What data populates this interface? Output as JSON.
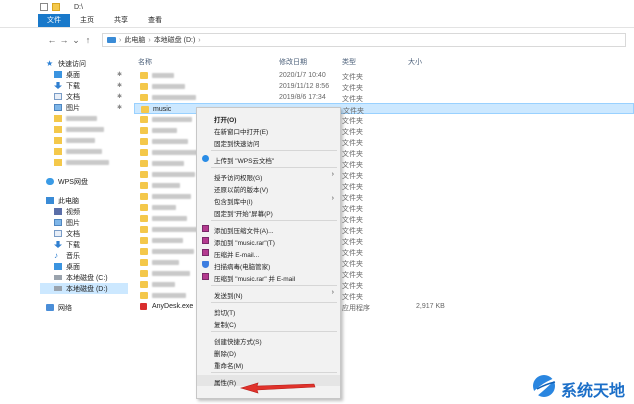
{
  "window": {
    "title": "D:\\"
  },
  "ribbon": {
    "tabs": [
      "文件",
      "主页",
      "共享",
      "查看"
    ]
  },
  "address": {
    "path": [
      "此电脑",
      "本地磁盘 (D:)"
    ]
  },
  "navpane": {
    "items": [
      {
        "label": "快速访问",
        "icon": "star-icon",
        "pin": false,
        "indent": 0
      },
      {
        "label": "桌面",
        "icon": "desktop-icon",
        "pin": true,
        "indent": 1
      },
      {
        "label": "下载",
        "icon": "download-icon",
        "pin": true,
        "indent": 1
      },
      {
        "label": "文档",
        "icon": "document-icon",
        "pin": true,
        "indent": 1
      },
      {
        "label": "图片",
        "icon": "picture-icon",
        "pin": true,
        "indent": 1
      },
      {
        "label": "",
        "icon": "folder-icon",
        "pin": false,
        "indent": 1,
        "blurred": true
      },
      {
        "label": "",
        "icon": "folder-icon",
        "pin": false,
        "indent": 1,
        "blurred": true
      },
      {
        "label": "",
        "icon": "folder-icon",
        "pin": false,
        "indent": 1,
        "blurred": true
      },
      {
        "label": "",
        "icon": "folder-icon",
        "pin": false,
        "indent": 1,
        "blurred": true
      },
      {
        "label": "",
        "icon": "folder-icon",
        "pin": false,
        "indent": 1,
        "blurred": true
      },
      {
        "label": "",
        "gap": true
      },
      {
        "label": "WPS网盘",
        "icon": "cloud-icon",
        "pin": false,
        "indent": 0
      },
      {
        "label": "",
        "gap": true
      },
      {
        "label": "此电脑",
        "icon": "pc-icon",
        "pin": false,
        "indent": 0
      },
      {
        "label": "视频",
        "icon": "video-icon",
        "pin": false,
        "indent": 1
      },
      {
        "label": "图片",
        "icon": "picture-icon",
        "pin": false,
        "indent": 1
      },
      {
        "label": "文档",
        "icon": "document-icon",
        "pin": false,
        "indent": 1
      },
      {
        "label": "下载",
        "icon": "download-icon",
        "pin": false,
        "indent": 1
      },
      {
        "label": "音乐",
        "icon": "music-icon",
        "pin": false,
        "indent": 1
      },
      {
        "label": "桌面",
        "icon": "desktop-icon",
        "pin": false,
        "indent": 1
      },
      {
        "label": "本地磁盘 (C:)",
        "icon": "drive-icon",
        "pin": false,
        "indent": 1
      },
      {
        "label": "本地磁盘 (D:)",
        "icon": "drive-icon",
        "pin": false,
        "indent": 1,
        "selected": true
      },
      {
        "label": "",
        "gap": true
      },
      {
        "label": "网络",
        "icon": "network-icon",
        "pin": false,
        "indent": 0
      }
    ]
  },
  "columns": {
    "name": "名称",
    "date": "修改日期",
    "type": "类型",
    "size": "大小"
  },
  "files": [
    {
      "name": "",
      "blurred": true,
      "date": "2020/1/7 10:40",
      "type": "文件夹",
      "size": ""
    },
    {
      "name": "",
      "blurred": true,
      "date": "2019/11/12 8:56",
      "type": "文件夹",
      "size": ""
    },
    {
      "name": "",
      "blurred": true,
      "date": "2019/8/6 17:34",
      "type": "文件夹",
      "size": ""
    },
    {
      "name": "music",
      "blurred": false,
      "date": "",
      "type": "文件夹",
      "size": "",
      "selected": true
    },
    {
      "name": "",
      "blurred": true,
      "date": "",
      "type": "文件夹",
      "size": ""
    },
    {
      "name": "",
      "blurred": true,
      "date": "",
      "type": "文件夹",
      "size": ""
    },
    {
      "name": "",
      "blurred": true,
      "date": "",
      "type": "文件夹",
      "size": ""
    },
    {
      "name": "",
      "blurred": true,
      "date": "",
      "type": "文件夹",
      "size": ""
    },
    {
      "name": "",
      "blurred": true,
      "date": "",
      "type": "文件夹",
      "size": ""
    },
    {
      "name": "",
      "blurred": true,
      "date": "",
      "type": "文件夹",
      "size": ""
    },
    {
      "name": "",
      "blurred": true,
      "date": "",
      "type": "文件夹",
      "size": ""
    },
    {
      "name": "",
      "blurred": true,
      "date": "",
      "type": "文件夹",
      "size": ""
    },
    {
      "name": "",
      "blurred": true,
      "date": "",
      "type": "文件夹",
      "size": ""
    },
    {
      "name": "",
      "blurred": true,
      "date": "",
      "type": "文件夹",
      "size": ""
    },
    {
      "name": "",
      "blurred": true,
      "date": "",
      "type": "文件夹",
      "size": ""
    },
    {
      "name": "",
      "blurred": true,
      "date": "",
      "type": "文件夹",
      "size": ""
    },
    {
      "name": "",
      "blurred": true,
      "date": "",
      "type": "文件夹",
      "size": ""
    },
    {
      "name": "",
      "blurred": true,
      "date": "",
      "type": "文件夹",
      "size": ""
    },
    {
      "name": "",
      "blurred": true,
      "date": "",
      "type": "文件夹",
      "size": ""
    },
    {
      "name": "",
      "blurred": true,
      "date": "",
      "type": "文件夹",
      "size": ""
    },
    {
      "name": "",
      "blurred": true,
      "date": "",
      "type": "文件夹",
      "size": ""
    },
    {
      "name": "AnyDesk.exe",
      "blurred": false,
      "date": "",
      "type": "应用程序",
      "size": "2,917 KB",
      "exe": true
    }
  ],
  "context_menu": {
    "items": [
      {
        "label": "打开(O)",
        "bold": true
      },
      {
        "label": "在新窗口中打开(E)"
      },
      {
        "label": "固定到快速访问"
      },
      {
        "sep": true
      },
      {
        "label": "上传到 \"WPS云文档\"",
        "icon": "wps-cloud-icon"
      },
      {
        "sep": true
      },
      {
        "label": "授予访问权限(G)",
        "submenu": true
      },
      {
        "label": "还原以前的版本(V)"
      },
      {
        "label": "包含到库中(I)",
        "submenu": true
      },
      {
        "label": "固定到\"开始\"屏幕(P)"
      },
      {
        "sep": true
      },
      {
        "label": "添加到压缩文件(A)...",
        "icon": "winrar-icon"
      },
      {
        "label": "添加到 \"music.rar\"(T)",
        "icon": "winrar-icon"
      },
      {
        "label": "压缩并 E-mail...",
        "icon": "winrar-icon"
      },
      {
        "label": "扫描病毒(电脑管家)",
        "icon": "shield-icon"
      },
      {
        "label": "压缩到 \"music.rar\" 并 E-mail",
        "icon": "winrar-icon"
      },
      {
        "sep": true
      },
      {
        "label": "发送到(N)",
        "submenu": true
      },
      {
        "sep": true
      },
      {
        "label": "剪切(T)"
      },
      {
        "label": "复制(C)"
      },
      {
        "sep": true
      },
      {
        "label": "创建快捷方式(S)"
      },
      {
        "label": "删除(D)"
      },
      {
        "label": "重命名(M)"
      },
      {
        "sep": true
      },
      {
        "label": "属性(R)",
        "highlight": true
      }
    ]
  },
  "watermark": {
    "text": "系统天地"
  },
  "colors": {
    "accent": "#1979ca",
    "selection": "#cce8ff",
    "annotation": "#e0322b",
    "folder": "#f4c84a"
  }
}
